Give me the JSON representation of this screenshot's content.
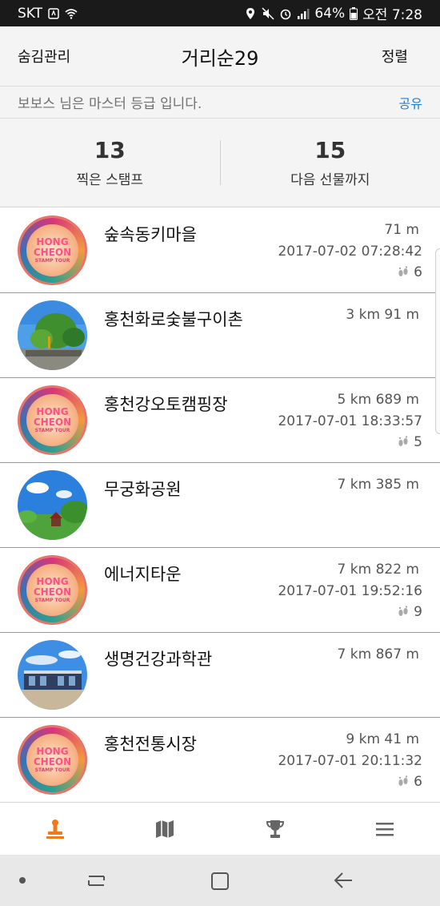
{
  "status_bar": {
    "carrier": "SKT",
    "battery": "64%",
    "time": "오전 7:28"
  },
  "header": {
    "left_label": "숨김관리",
    "title": "거리순29",
    "right_label": "정렬"
  },
  "info_bar": {
    "message": "보보스 님은 마스터 등급 입니다.",
    "share_label": "공유"
  },
  "stats": {
    "stamped_count": "13",
    "stamped_label": "찍은 스탬프",
    "next_gift_count": "15",
    "next_gift_label": "다음 선물까지"
  },
  "places": [
    {
      "name": "숲속동키마을",
      "distance": "71 m",
      "date": "2017-07-02 07:28:42",
      "visits": "6",
      "image": "stamp"
    },
    {
      "name": "홍천화로숯불구이촌",
      "distance": "3 km 91 m",
      "date": "",
      "visits": "",
      "image": "photo-trees"
    },
    {
      "name": "홍천강오토캠핑장",
      "distance": "5 km 689 m",
      "date": "2017-07-01 18:33:57",
      "visits": "5",
      "image": "stamp"
    },
    {
      "name": "무궁화공원",
      "distance": "7 km 385 m",
      "date": "",
      "visits": "",
      "image": "photo-park"
    },
    {
      "name": "에너지타운",
      "distance": "7 km 822 m",
      "date": "2017-07-01 19:52:16",
      "visits": "9",
      "image": "stamp"
    },
    {
      "name": "생명건강과학관",
      "distance": "7 km 867 m",
      "date": "",
      "visits": "",
      "image": "photo-building"
    },
    {
      "name": "홍천전통시장",
      "distance": "9 km 41 m",
      "date": "2017-07-01 20:11:32",
      "visits": "6",
      "image": "stamp"
    }
  ],
  "stamp_logo": {
    "line1": "HONG",
    "line2": "CHEON",
    "line3": "STAMP TOUR"
  },
  "bottom_nav": {
    "active_color": "#f07a1a",
    "inactive_color": "#666666",
    "items": [
      "stamp-icon",
      "map-icon",
      "trophy-icon",
      "menu-icon"
    ]
  }
}
